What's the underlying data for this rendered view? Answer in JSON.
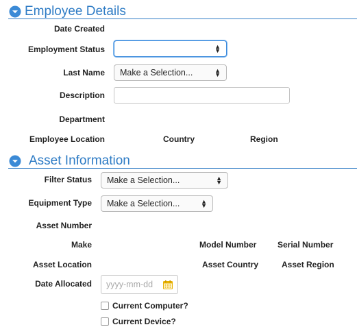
{
  "employee_details": {
    "title": "Employee Details",
    "date_created_label": "Date Created",
    "employment_status_label": "Employment Status",
    "employment_status_value": "",
    "last_name_label": "Last Name",
    "last_name_value": "Make a Selection...",
    "description_label": "Description",
    "description_value": "",
    "department_label": "Department",
    "employee_location_label": "Employee Location",
    "country_label": "Country",
    "region_label": "Region"
  },
  "asset_information": {
    "title": "Asset Information",
    "filter_status_label": "Filter Status",
    "filter_status_value": "Make a Selection...",
    "equipment_type_label": "Equipment Type",
    "equipment_type_value": "Make a Selection...",
    "asset_number_label": "Asset Number",
    "make_label": "Make",
    "model_number_label": "Model Number",
    "serial_number_label": "Serial Number",
    "asset_location_label": "Asset Location",
    "asset_country_label": "Asset Country",
    "asset_region_label": "Asset Region",
    "date_allocated_label": "Date Allocated",
    "date_allocated_placeholder": "yyyy-mm-dd",
    "current_computer_label": "Current Computer?",
    "current_device_label": "Current Device?"
  },
  "icons": {
    "section_toggle": "chevron-down-circle-icon",
    "calendar": "calendar-icon",
    "select_arrows": "up-down-arrows-icon"
  },
  "colors": {
    "accent": "#2f7cc5",
    "calendar_icon": "#e8b100"
  }
}
